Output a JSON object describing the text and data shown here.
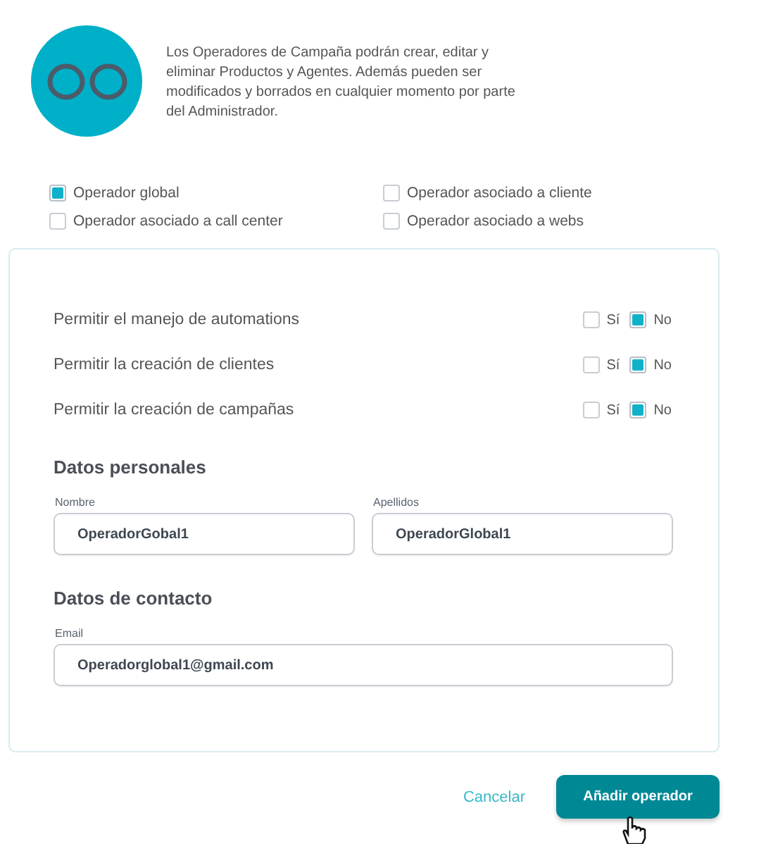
{
  "intro": {
    "text": "Los Operadores de Campaña podrán crear, editar y eliminar Productos y Agentes. Además pueden ser modificados y borrados en cualquier momento por parte del Administrador."
  },
  "operator_types": [
    {
      "label": "Operador global",
      "checked": true
    },
    {
      "label": "Operador asociado a cliente",
      "checked": false
    },
    {
      "label": "Operador asociado a call center",
      "checked": false
    },
    {
      "label": "Operador asociado a webs",
      "checked": false
    }
  ],
  "permissions": [
    {
      "label": "Permitir el manejo de automations",
      "options": [
        {
          "label": "Sí",
          "checked": false
        },
        {
          "label": "No",
          "checked": true
        }
      ]
    },
    {
      "label": "Permitir la creación de clientes",
      "options": [
        {
          "label": "Sí",
          "checked": false
        },
        {
          "label": "No",
          "checked": true
        }
      ]
    },
    {
      "label": "Permitir la creación de campañas",
      "options": [
        {
          "label": "Sí",
          "checked": false
        },
        {
          "label": "No",
          "checked": true
        }
      ]
    }
  ],
  "sections": [
    {
      "title": "Datos personales",
      "fields": [
        {
          "label": "Nombre",
          "value": "OperadorGobal1"
        },
        {
          "label": "Apellidos",
          "value": "OperadorGlobal1"
        }
      ]
    },
    {
      "title": "Datos de contacto",
      "fields": [
        {
          "label": "Email",
          "value": "Operadorglobal1@gmail.com"
        }
      ]
    }
  ],
  "actions": {
    "cancel": "Cancelar",
    "submit": "Añadir operador"
  }
}
